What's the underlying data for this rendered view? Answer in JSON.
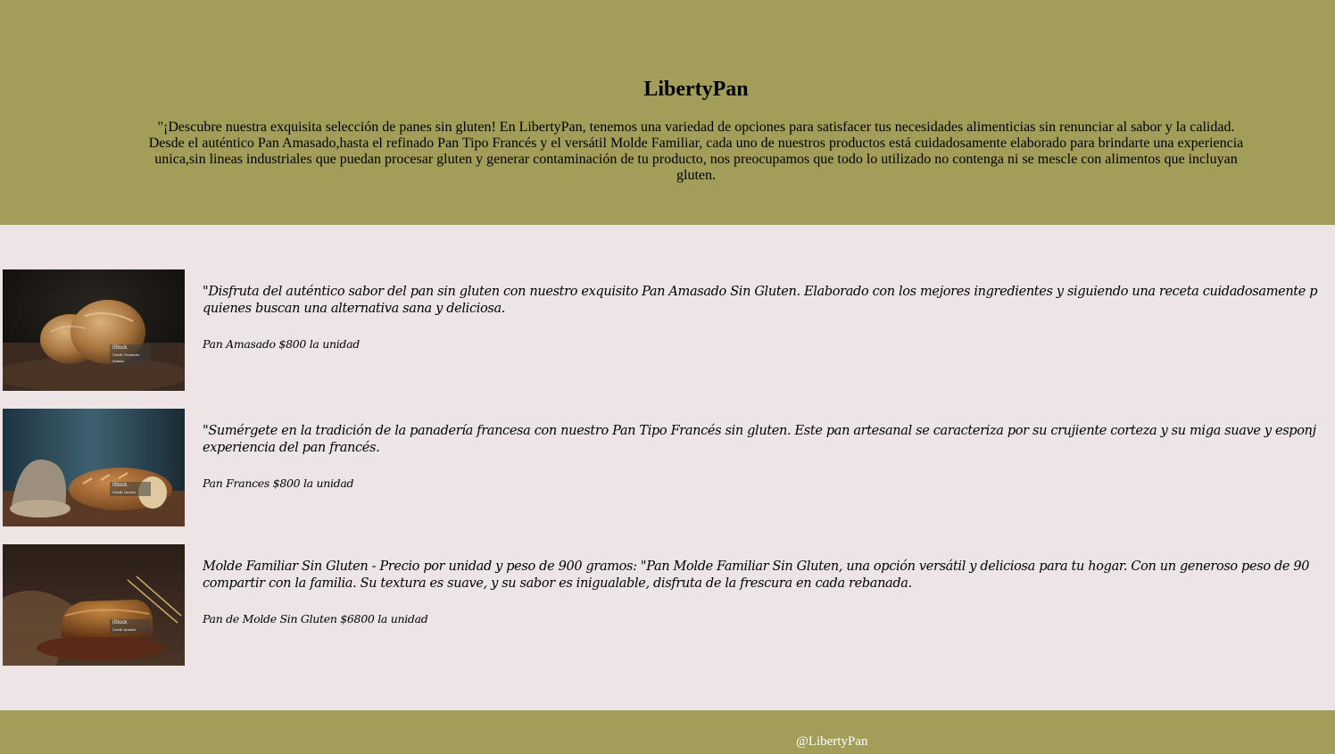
{
  "header": {
    "title": "LibertyPan",
    "intro": "\"¡Descubre nuestra exquisita selección de panes sin gluten! En LibertyPan, tenemos una variedad de opciones para satisfacer tus necesidades alimenticias sin renunciar al sabor y la calidad. Desde el auténtico Pan Amasado,hasta el refinado Pan Tipo Francés y el versátil Molde Familiar, cada uno de nuestros productos está cuidadosamente elaborado para brindarte una experiencia unica,sin lineas industriales que puedan procesar gluten y generar contaminación de tu producto, nos preocupamos que todo lo utilizado no contenga ni se mescle con alimentos que incluyan gluten."
  },
  "products": [
    {
      "image": "pan-amasado-photo",
      "description": "\"Disfruta del auténtico sabor del pan sin gluten con nuestro exquisito Pan Amasado Sin Gluten. Elaborado con los mejores ingredientes y siguiendo una receta cuidadosamente p",
      "description_line2": "quienes buscan una alternativa sana y deliciosa.",
      "price": "Pan Amasado $800 la unidad",
      "watermark": "iStock",
      "watermark_credit": "Credit: Fernando Astasio"
    },
    {
      "image": "pan-frances-photo",
      "description": "\"Sumérgete en la tradición de la panadería francesa con nuestro Pan Tipo Francés sin gluten. Este pan artesanal se caracteriza por su crujiente corteza y su miga suave y esponj",
      "description_line2": "experiencia del pan francés.",
      "price": "Pan Frances $800 la unidad",
      "watermark": "iStock",
      "watermark_credit": "Credit: Lanoch"
    },
    {
      "image": "pan-molde-photo",
      "description": "Molde Familiar Sin Gluten - Precio por unidad y peso de 900 gramos: \"Pan Molde Familiar Sin Gluten, una opción versátil y deliciosa para tu hogar. Con un generoso peso de 90",
      "description_line2": "compartir con la familia. Su textura es suave, y su sabor es inigualable, disfruta de la frescura en cada rebanada.",
      "price": "Pan de Molde Sin Gluten $6800 la unidad",
      "watermark": "iStock",
      "watermark_credit": "Credit: Anatolii"
    }
  ],
  "footer": {
    "handle": "@LibertyPan"
  },
  "colors": {
    "header_bg": "#a29e5a",
    "body_bg": "#ece4e5",
    "footer_text": "#ffffff"
  }
}
